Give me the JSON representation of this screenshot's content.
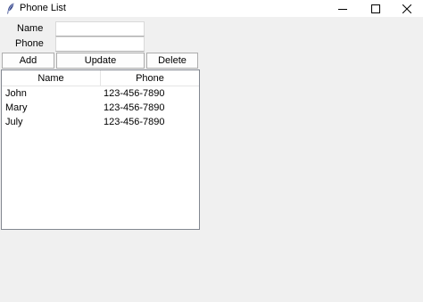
{
  "window": {
    "title": "Phone List",
    "controls": [
      "minimize-icon",
      "maximize-icon",
      "close-icon"
    ]
  },
  "form": {
    "name_label": "Name",
    "phone_label": "Phone",
    "name_value": "",
    "phone_value": ""
  },
  "buttons": {
    "add": "Add",
    "update": "Update",
    "delete": "Delete"
  },
  "table": {
    "columns": [
      "Name",
      "Phone"
    ],
    "rows": [
      {
        "name": "John",
        "phone": "123-456-7890"
      },
      {
        "name": "Mary",
        "phone": "123-456-7890"
      },
      {
        "name": "July",
        "phone": "123-456-7890"
      }
    ]
  }
}
